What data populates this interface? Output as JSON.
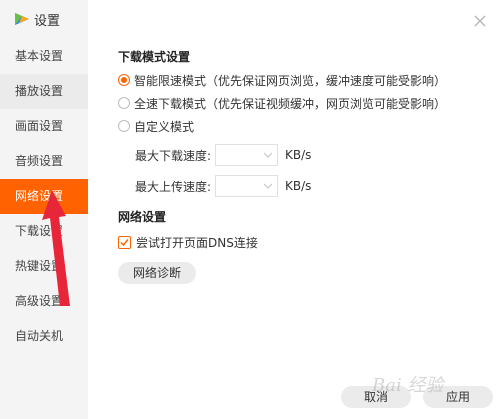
{
  "window": {
    "title": "设置"
  },
  "sidebar": {
    "items": [
      {
        "label": "基本设置",
        "state": "normal"
      },
      {
        "label": "播放设置",
        "state": "hover"
      },
      {
        "label": "画面设置",
        "state": "normal"
      },
      {
        "label": "音频设置",
        "state": "normal"
      },
      {
        "label": "网络设置",
        "state": "active"
      },
      {
        "label": "下载设置",
        "state": "normal"
      },
      {
        "label": "热键设置",
        "state": "normal"
      },
      {
        "label": "高级设置",
        "state": "normal"
      },
      {
        "label": "自动关机",
        "state": "normal"
      }
    ]
  },
  "download": {
    "title": "下载模式设置",
    "options": [
      {
        "label": "智能限速模式（优先保证网页浏览，缓冲速度可能受影响）",
        "checked": true
      },
      {
        "label": "全速下载模式（优先保证视频缓冲，网页浏览可能受影响）",
        "checked": false
      },
      {
        "label": "自定义模式",
        "checked": false
      }
    ],
    "max_download_label": "最大下载速度:",
    "max_download_value": "",
    "max_upload_label": "最大上传速度:",
    "max_upload_value": "",
    "unit": "KB/s"
  },
  "network": {
    "title": "网络设置",
    "dns_label": "尝试打开页面DNS连接",
    "dns_checked": true,
    "diagnose_label": "网络诊断"
  },
  "footer": {
    "cancel_label": "取消",
    "apply_label": "应用"
  },
  "watermark": "Bai 经验",
  "colors": {
    "accent": "#ff6200",
    "sidebar_bg": "#f4f4f4",
    "button_bg": "#ebebeb",
    "arrow": "#e8263a"
  },
  "icons": {
    "logo": "play-logo-icon",
    "close": "close-icon",
    "dropdown": "chevron-down-icon",
    "check": "check-icon"
  }
}
